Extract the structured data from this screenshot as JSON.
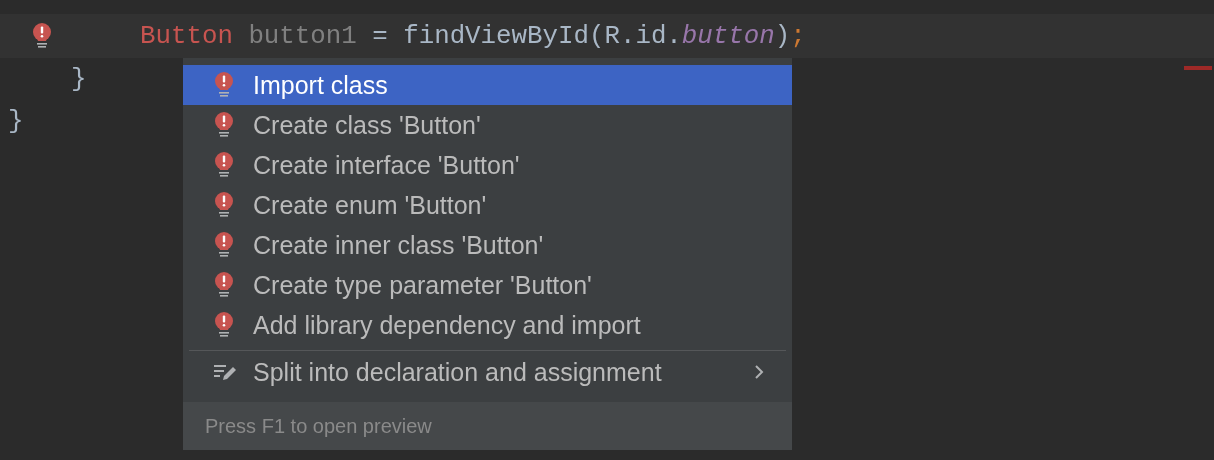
{
  "editor": {
    "lines": [
      {
        "kind": "statement",
        "current": true,
        "error_marker": true,
        "tokens": [
          {
            "kind": "type-error",
            "text": "Button"
          },
          {
            "kind": "unused",
            "text": "button1"
          },
          {
            "kind": "plain",
            "text": "= findViewById(R.id."
          },
          {
            "kind": "field",
            "text": "button"
          },
          {
            "kind": "plain",
            "text": ")"
          },
          {
            "kind": "semicolon",
            "text": ";"
          }
        ]
      },
      {
        "kind": "block-end",
        "current": false,
        "tokens": [
          {
            "kind": "plain",
            "text": "}"
          }
        ]
      },
      {
        "kind": "class-end",
        "current": false,
        "tokens": [
          {
            "kind": "plain",
            "text": "}"
          }
        ]
      }
    ],
    "error_stripe": true
  },
  "popup": {
    "items": [
      {
        "kind": "quick-fix",
        "label": "Import class",
        "selected": true
      },
      {
        "kind": "quick-fix",
        "label": "Create class 'Button'",
        "selected": false
      },
      {
        "kind": "quick-fix",
        "label": "Create interface 'Button'",
        "selected": false
      },
      {
        "kind": "quick-fix",
        "label": "Create enum 'Button'",
        "selected": false
      },
      {
        "kind": "quick-fix",
        "label": "Create inner class 'Button'",
        "selected": false
      },
      {
        "kind": "quick-fix",
        "label": "Create type parameter 'Button'",
        "selected": false
      },
      {
        "kind": "quick-fix",
        "label": "Add library dependency and import",
        "selected": false
      },
      {
        "kind": "intention",
        "label": "Split into declaration and assignment",
        "selected": false,
        "separator_before": true,
        "submenu": true
      }
    ],
    "footer": "Press F1 to open preview"
  }
}
